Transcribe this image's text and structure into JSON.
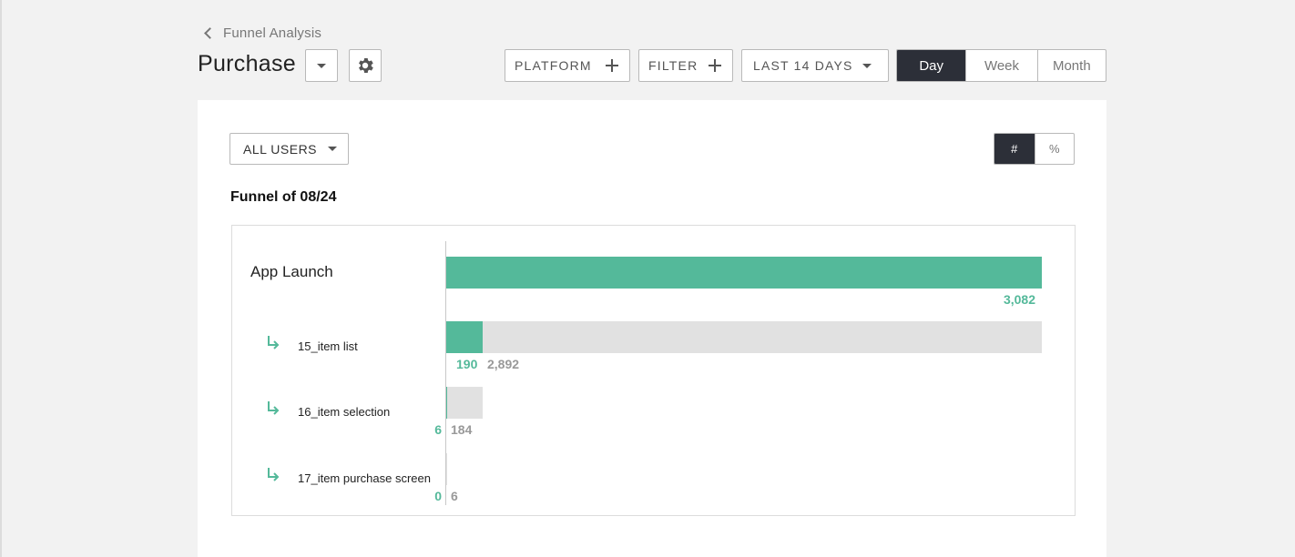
{
  "breadcrumb": {
    "label": "Funnel Analysis",
    "icon": "chevron-left-icon"
  },
  "header": {
    "title": "Purchase"
  },
  "toolbar": {
    "platform_label": "PLATFORM",
    "filter_label": "FILTER",
    "date_range_label": "LAST 14 DAYS",
    "granularity": [
      "Day",
      "Week",
      "Month"
    ],
    "granularity_selected": "Day"
  },
  "card": {
    "users_dropdown": "ALL USERS",
    "display_toggle": [
      "#",
      "%"
    ],
    "display_selected": "#",
    "funnel_title": "Funnel of 08/24"
  },
  "colors": {
    "accent": "#54b99a",
    "dark": "#2c2f38",
    "dropoff": "#e1e1e1"
  },
  "chart_data": {
    "type": "bar",
    "orientation": "horizontal",
    "categories": [
      "App Launch",
      "15_item list",
      "16_item selection",
      "17_item purchase screen"
    ],
    "series": [
      {
        "values": [
          3082,
          190,
          6,
          0
        ]
      },
      {
        "values": [
          null,
          2892,
          184,
          6
        ]
      }
    ],
    "value_labels": {
      "converted": [
        "3,082",
        "190",
        "6",
        "0"
      ],
      "dropped": [
        "",
        "2,892",
        "184",
        "6"
      ]
    },
    "xlim": [
      0,
      3082
    ]
  }
}
